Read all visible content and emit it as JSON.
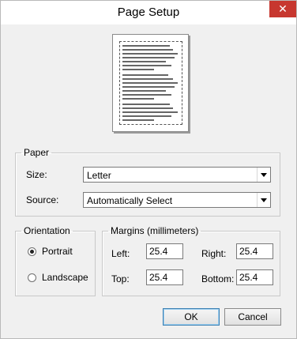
{
  "window": {
    "title": "Page Setup",
    "close_icon": "close-icon"
  },
  "paper": {
    "legend": "Paper",
    "size_label": "Size:",
    "size_value": "Letter",
    "source_label": "Source:",
    "source_value": "Automatically Select"
  },
  "orientation": {
    "legend": "Orientation",
    "portrait_label": "Portrait",
    "landscape_label": "Landscape",
    "selected": "Portrait"
  },
  "margins": {
    "legend": "Margins (millimeters)",
    "left_label": "Left:",
    "left_value": "25.4",
    "right_label": "Right:",
    "right_value": "25.4",
    "top_label": "Top:",
    "top_value": "25.4",
    "bottom_label": "Bottom:",
    "bottom_value": "25.4"
  },
  "buttons": {
    "ok": "OK",
    "cancel": "Cancel"
  }
}
